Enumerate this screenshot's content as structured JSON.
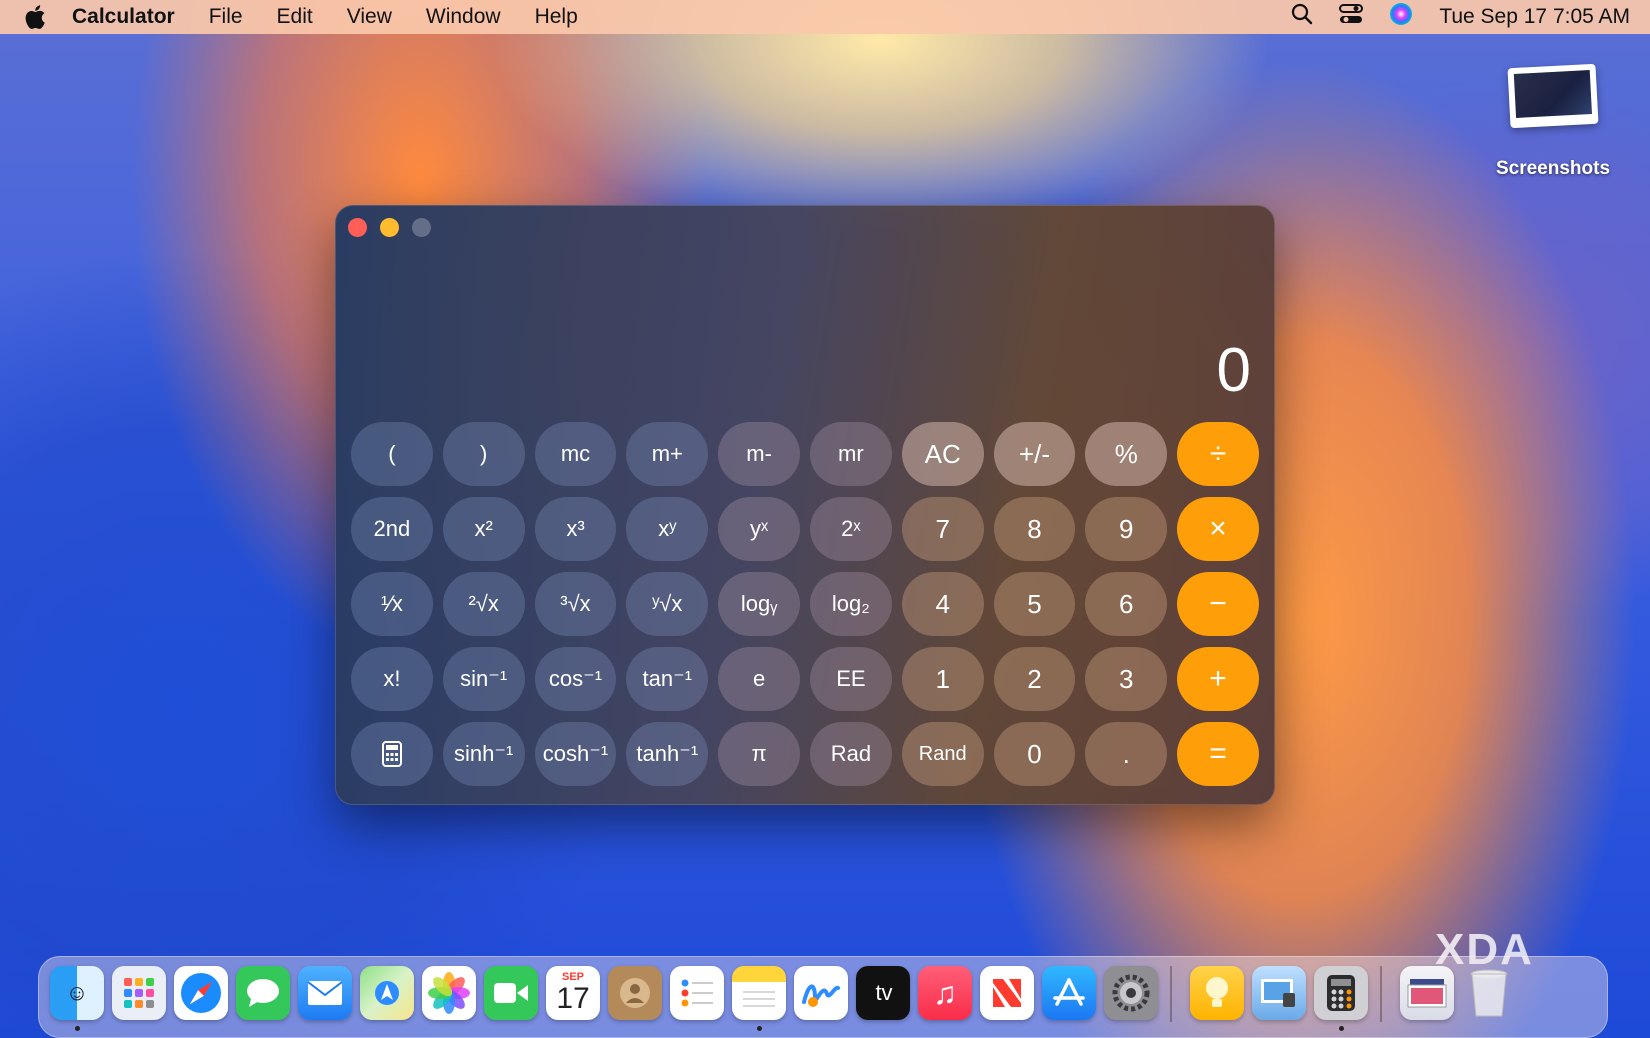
{
  "menubar": {
    "app_name": "Calculator",
    "menus": [
      "File",
      "Edit",
      "View",
      "Window",
      "Help"
    ],
    "clock": "Tue Sep 17  7:05 AM"
  },
  "desktop": {
    "icon_label": "Screenshots"
  },
  "calculator": {
    "display": "0",
    "rows": [
      [
        "(",
        ")",
        "mc",
        "m+",
        "m-",
        "mr",
        "AC",
        "+/-",
        "%",
        "÷"
      ],
      [
        "2nd",
        "x²",
        "x³",
        "xʸ",
        "yˣ",
        "2ˣ",
        "7",
        "8",
        "9",
        "×"
      ],
      [
        "¹⁄x",
        "²√x",
        "³√x",
        "ʸ√x",
        "logᵧ",
        "log₂",
        "4",
        "5",
        "6",
        "−"
      ],
      [
        "x!",
        "sin⁻¹",
        "cos⁻¹",
        "tan⁻¹",
        "e",
        "EE",
        "1",
        "2",
        "3",
        "+"
      ],
      [
        "▦",
        "sinh⁻¹",
        "cosh⁻¹",
        "tanh⁻¹",
        "π",
        "Rad",
        "Rand",
        "0",
        ".",
        "="
      ]
    ]
  },
  "dock": {
    "calendar_month": "SEP",
    "calendar_day": "17",
    "tv_label": "tv"
  },
  "watermark": "XDA",
  "colors": {
    "operator": "#fe9f0a",
    "close": "#ff5f57",
    "minimize": "#febc2e"
  }
}
